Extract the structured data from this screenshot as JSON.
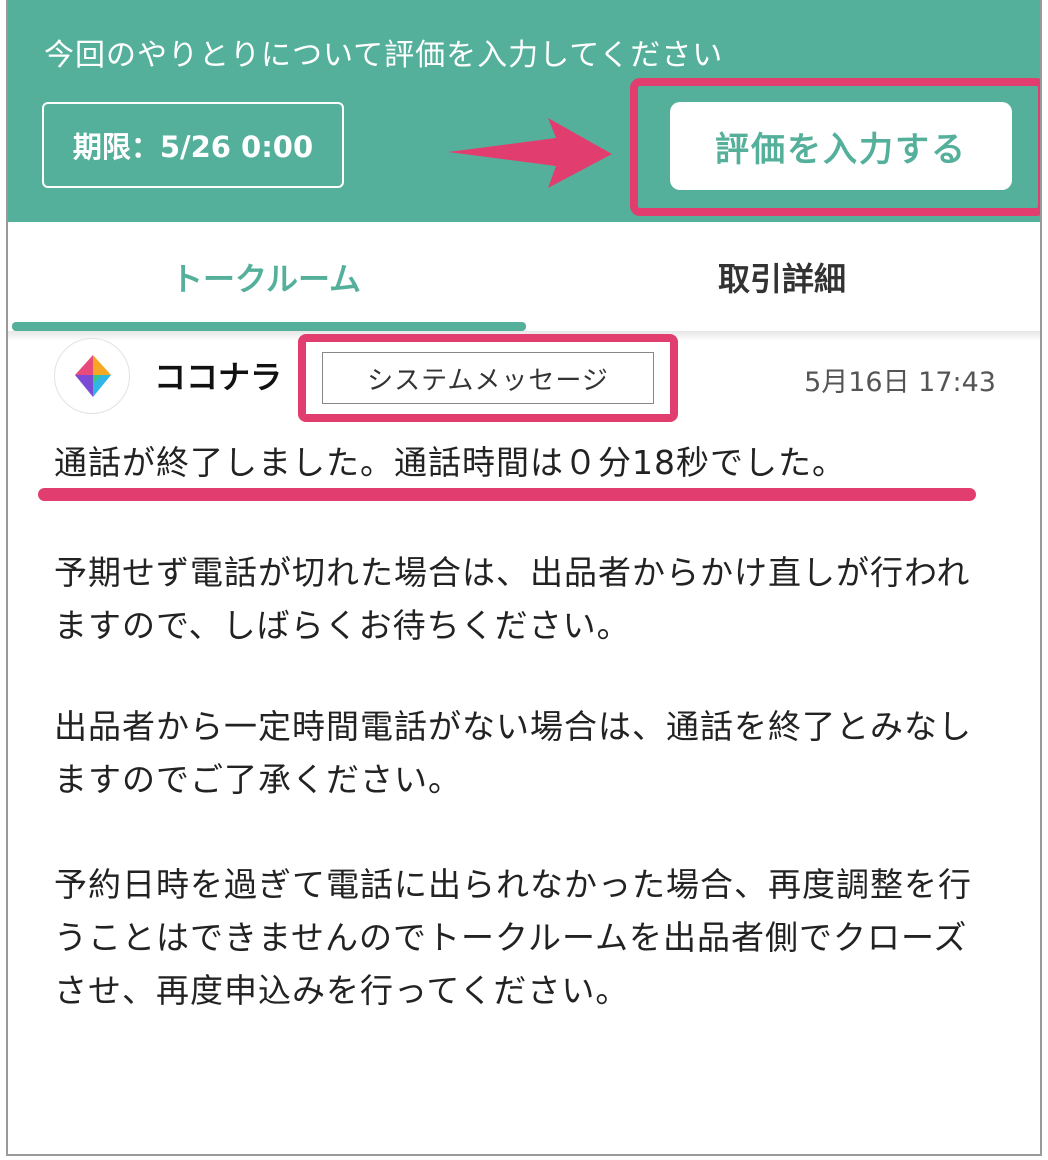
{
  "banner": {
    "title": "今回のやりとりについて評価を入力してください",
    "deadline": "期限：5/26 0:00",
    "rate_button": "評価を入力する"
  },
  "tabs": [
    {
      "label": "トークルーム",
      "active": true
    },
    {
      "label": "取引詳細",
      "active": false
    }
  ],
  "message": {
    "sender": "ココナラ",
    "badge": "システムメッセージ",
    "timestamp": "5月16日 17:43",
    "line1": "通話が終了しました。通話時間は０分18秒でした。",
    "para2": "予期せず電話が切れた場合は、出品者からかけ直しが行われますので、しばらくお待ちください。",
    "para3": "出品者から一定時間電話がない場合は、通話を終了とみなしますのでご了承ください。",
    "para4": "予約日時を過ぎて電話に出られなかった場合、再度調整を行うことはできませんのでトークルームを出品者側でクローズさせ、再度申込みを行ってください。"
  },
  "colors": {
    "accent": "#55b09b",
    "highlight": "#e23d6f",
    "text": "#222222"
  }
}
